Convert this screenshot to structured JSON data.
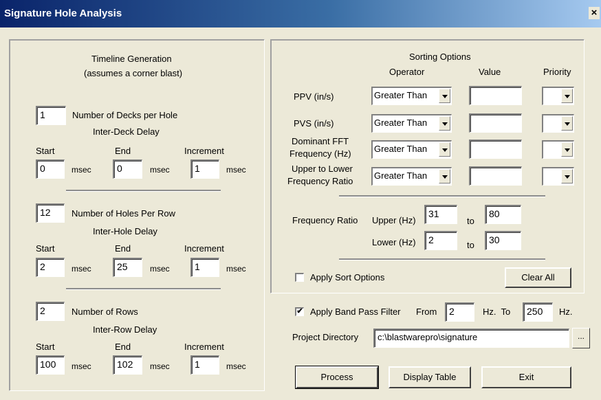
{
  "window": {
    "title": "Signature Hole Analysis",
    "close_symbol": "×"
  },
  "timeline": {
    "title": "Timeline Generation",
    "subtitle": "(assumes a corner blast)",
    "decks": {
      "count_value": "1",
      "count_label": "Number of Decks per Hole",
      "delay_label": "Inter-Deck Delay",
      "start_label": "Start",
      "end_label": "End",
      "increment_label": "Increment",
      "start": "0",
      "end": "0",
      "increment": "1"
    },
    "holes": {
      "count_value": "12",
      "count_label": "Number of Holes Per Row",
      "delay_label": "Inter-Hole Delay",
      "start_label": "Start",
      "end_label": "End",
      "increment_label": "Increment",
      "start": "2",
      "end": "25",
      "increment": "1"
    },
    "rows": {
      "count_value": "2",
      "count_label": "Number of Rows",
      "delay_label": "Inter-Row Delay",
      "start_label": "Start",
      "end_label": "End",
      "increment_label": "Increment",
      "start": "100",
      "end": "102",
      "increment": "1"
    },
    "unit": "msec"
  },
  "sorting": {
    "title": "Sorting Options",
    "col_operator": "Operator",
    "col_value": "Value",
    "col_priority": "Priority",
    "rows": [
      {
        "label": "PPV (in/s)",
        "operator": "Greater Than",
        "value": "",
        "priority": ""
      },
      {
        "label": "PVS (in/s)",
        "operator": "Greater Than",
        "value": "",
        "priority": ""
      },
      {
        "label_line1": "Dominant FFT",
        "label_line2": "Frequency (Hz)",
        "operator": "Greater Than",
        "value": "",
        "priority": ""
      },
      {
        "label_line1": "Upper to Lower",
        "label_line2": "Frequency Ratio",
        "operator": "Greater Than",
        "value": "",
        "priority": ""
      }
    ],
    "freq_ratio_label": "Frequency Ratio",
    "upper_label": "Upper (Hz)",
    "upper_from": "31",
    "upper_to": "80",
    "lower_label": "Lower (Hz)",
    "lower_from": "2",
    "lower_to": "30",
    "to_label": "to",
    "apply_sort_label": "Apply Sort Options",
    "apply_sort_checked": false,
    "clear_all_label": "Clear All"
  },
  "filter": {
    "label": "Apply Band Pass Filter",
    "checked": true,
    "check_mark": "✔",
    "from_label": "From",
    "from_value": "2",
    "hz_to_label": "Hz.  To",
    "to_value": "250",
    "hz_label": "Hz."
  },
  "project": {
    "label": "Project Directory",
    "value": "c:\\blastwarepro\\signature",
    "browse_label": "..."
  },
  "buttons": {
    "process": "Process",
    "display_table": "Display Table",
    "exit": "Exit"
  }
}
